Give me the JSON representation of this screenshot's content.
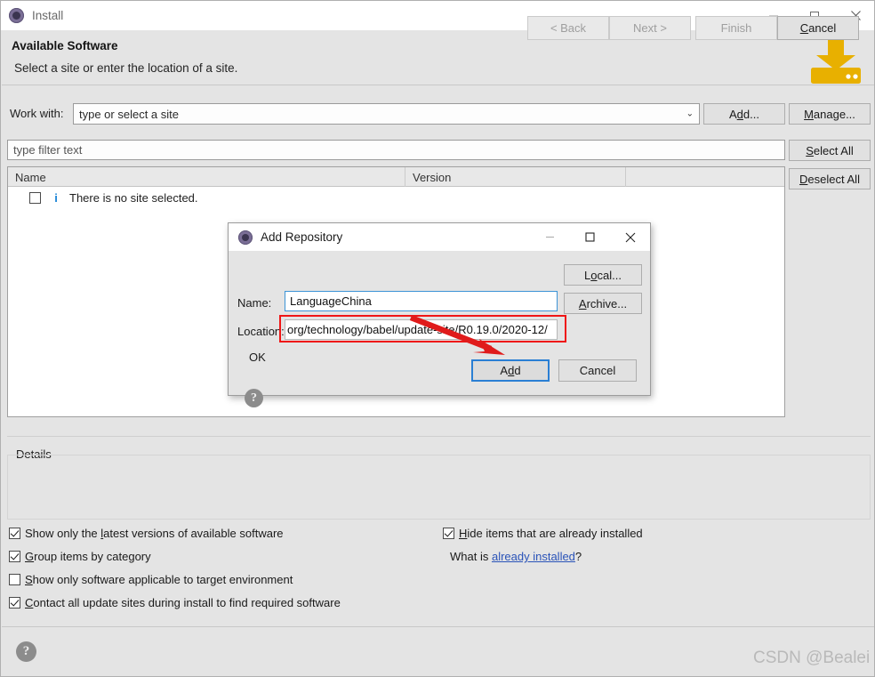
{
  "window": {
    "title": "Install",
    "icon": "eclipse-gear-icon",
    "controls": {
      "minimize": "minimize-icon",
      "maximize": "maximize-icon",
      "close": "close-icon"
    }
  },
  "header": {
    "title": "Available Software",
    "subtitle": "Select a site or enter the location of a site.",
    "banner_icon": "install-download-icon",
    "banner_color": "#e8b000"
  },
  "work_with": {
    "label": "Work with:",
    "placeholder": "type or select a site",
    "value": "",
    "dropdown_icon": "chevron-down-icon",
    "add_button": {
      "prefix": "A",
      "underlined": "d",
      "suffix": "d..."
    },
    "add_label": "Add...",
    "manage_button": {
      "prefix": "",
      "underlined": "M",
      "suffix": "anage..."
    },
    "manage_label": "Manage..."
  },
  "filter": {
    "placeholder": "type filter text",
    "value": ""
  },
  "side_buttons": {
    "select_all": {
      "underlined": "S",
      "suffix": "elect All"
    },
    "select_all_label": "Select All",
    "deselect_all": {
      "underlined": "D",
      "suffix": "eselect All"
    },
    "deselect_all_label": "Deselect All"
  },
  "table": {
    "columns": [
      "Name",
      "Version",
      ""
    ],
    "rows": [
      {
        "checked": false,
        "icon": "info-icon",
        "name": "There is no site selected.",
        "version": ""
      }
    ]
  },
  "details": {
    "legend": "Details",
    "content": ""
  },
  "options": [
    {
      "checked": true,
      "pre": "Show only the ",
      "underlined": "l",
      "post": "atest versions of available software"
    },
    {
      "checked": true,
      "pre": "",
      "underlined": "G",
      "post": "roup items by category"
    },
    {
      "checked": false,
      "pre": "",
      "underlined": "S",
      "post": "how only software applicable to target environment"
    },
    {
      "checked": true,
      "pre": "",
      "underlined": "C",
      "post": "ontact all update sites during install to find required software"
    }
  ],
  "options_right": {
    "hide_installed": {
      "checked": true,
      "underlined": "H",
      "post": "ide items that are already installed"
    },
    "what_is_prefix": "What is ",
    "what_is_link": "already installed",
    "what_is_suffix": "?"
  },
  "footer": {
    "help_icon": "help-question-icon",
    "back": "< Back",
    "next": "Next >",
    "finish": "Finish",
    "cancel": "Cancel",
    "cancel_underlined": "C",
    "cancel_rest": "ancel"
  },
  "watermark": "CSDN @Bealei",
  "dialog": {
    "title": "Add Repository",
    "icon": "eclipse-gear-icon",
    "controls": {
      "minimize": "minimize-icon",
      "maximize": "maximize-icon",
      "close": "close-icon"
    },
    "name_label": "Name:",
    "name_value": "LanguageChina",
    "location_label": "Location:",
    "location_value": "org/technology/babel/update-site/R0.19.0/2020-12/",
    "local_button": {
      "pre": "L",
      "underlined": "o",
      "post": "cal..."
    },
    "local_label": "Local...",
    "archive_button": {
      "pre": "",
      "underlined": "A",
      "post": "rchive..."
    },
    "archive_label": "Archive...",
    "status_text": "OK",
    "help_icon": "help-question-icon",
    "add_button": {
      "pre": "A",
      "underlined": "d",
      "post": "d"
    },
    "add_label": "Add",
    "cancel_label": "Cancel"
  },
  "annotations": {
    "highlight_color": "#ef1616",
    "arrow_color": "#e01b1b",
    "arrow_from": "468,359",
    "arrow_to": "565,397"
  }
}
